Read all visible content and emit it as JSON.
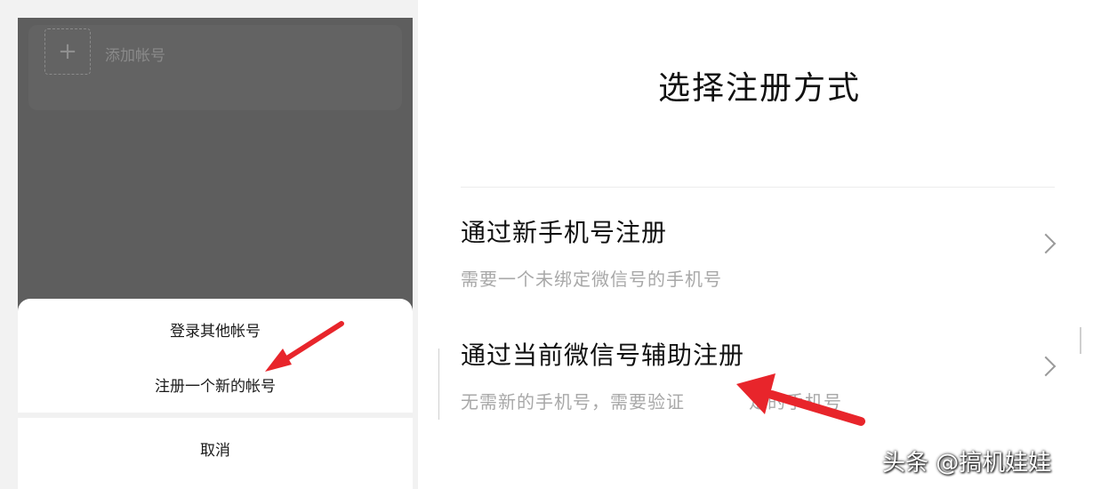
{
  "left_screen": {
    "add_account": {
      "icon": "plus-icon",
      "icon_glyph": "+",
      "label": "添加帐号"
    },
    "sheet": {
      "login_other": "登录其他帐号",
      "register_new": "注册一个新的帐号",
      "cancel": "取消"
    }
  },
  "right_screen": {
    "title": "选择注册方式",
    "options": [
      {
        "title": "通过新手机号注册",
        "subtitle": "需要一个未绑定微信号的手机号",
        "icon": "chevron-right-icon"
      },
      {
        "title": "通过当前微信号辅助注册",
        "subtitle": "无需新的手机号，需要验证",
        "subtitle_tail": "定的手机号",
        "icon": "chevron-right-icon"
      }
    ]
  },
  "annotations": {
    "arrow_color": "#e8252b"
  },
  "watermark": "头条 @搞机娃娃"
}
